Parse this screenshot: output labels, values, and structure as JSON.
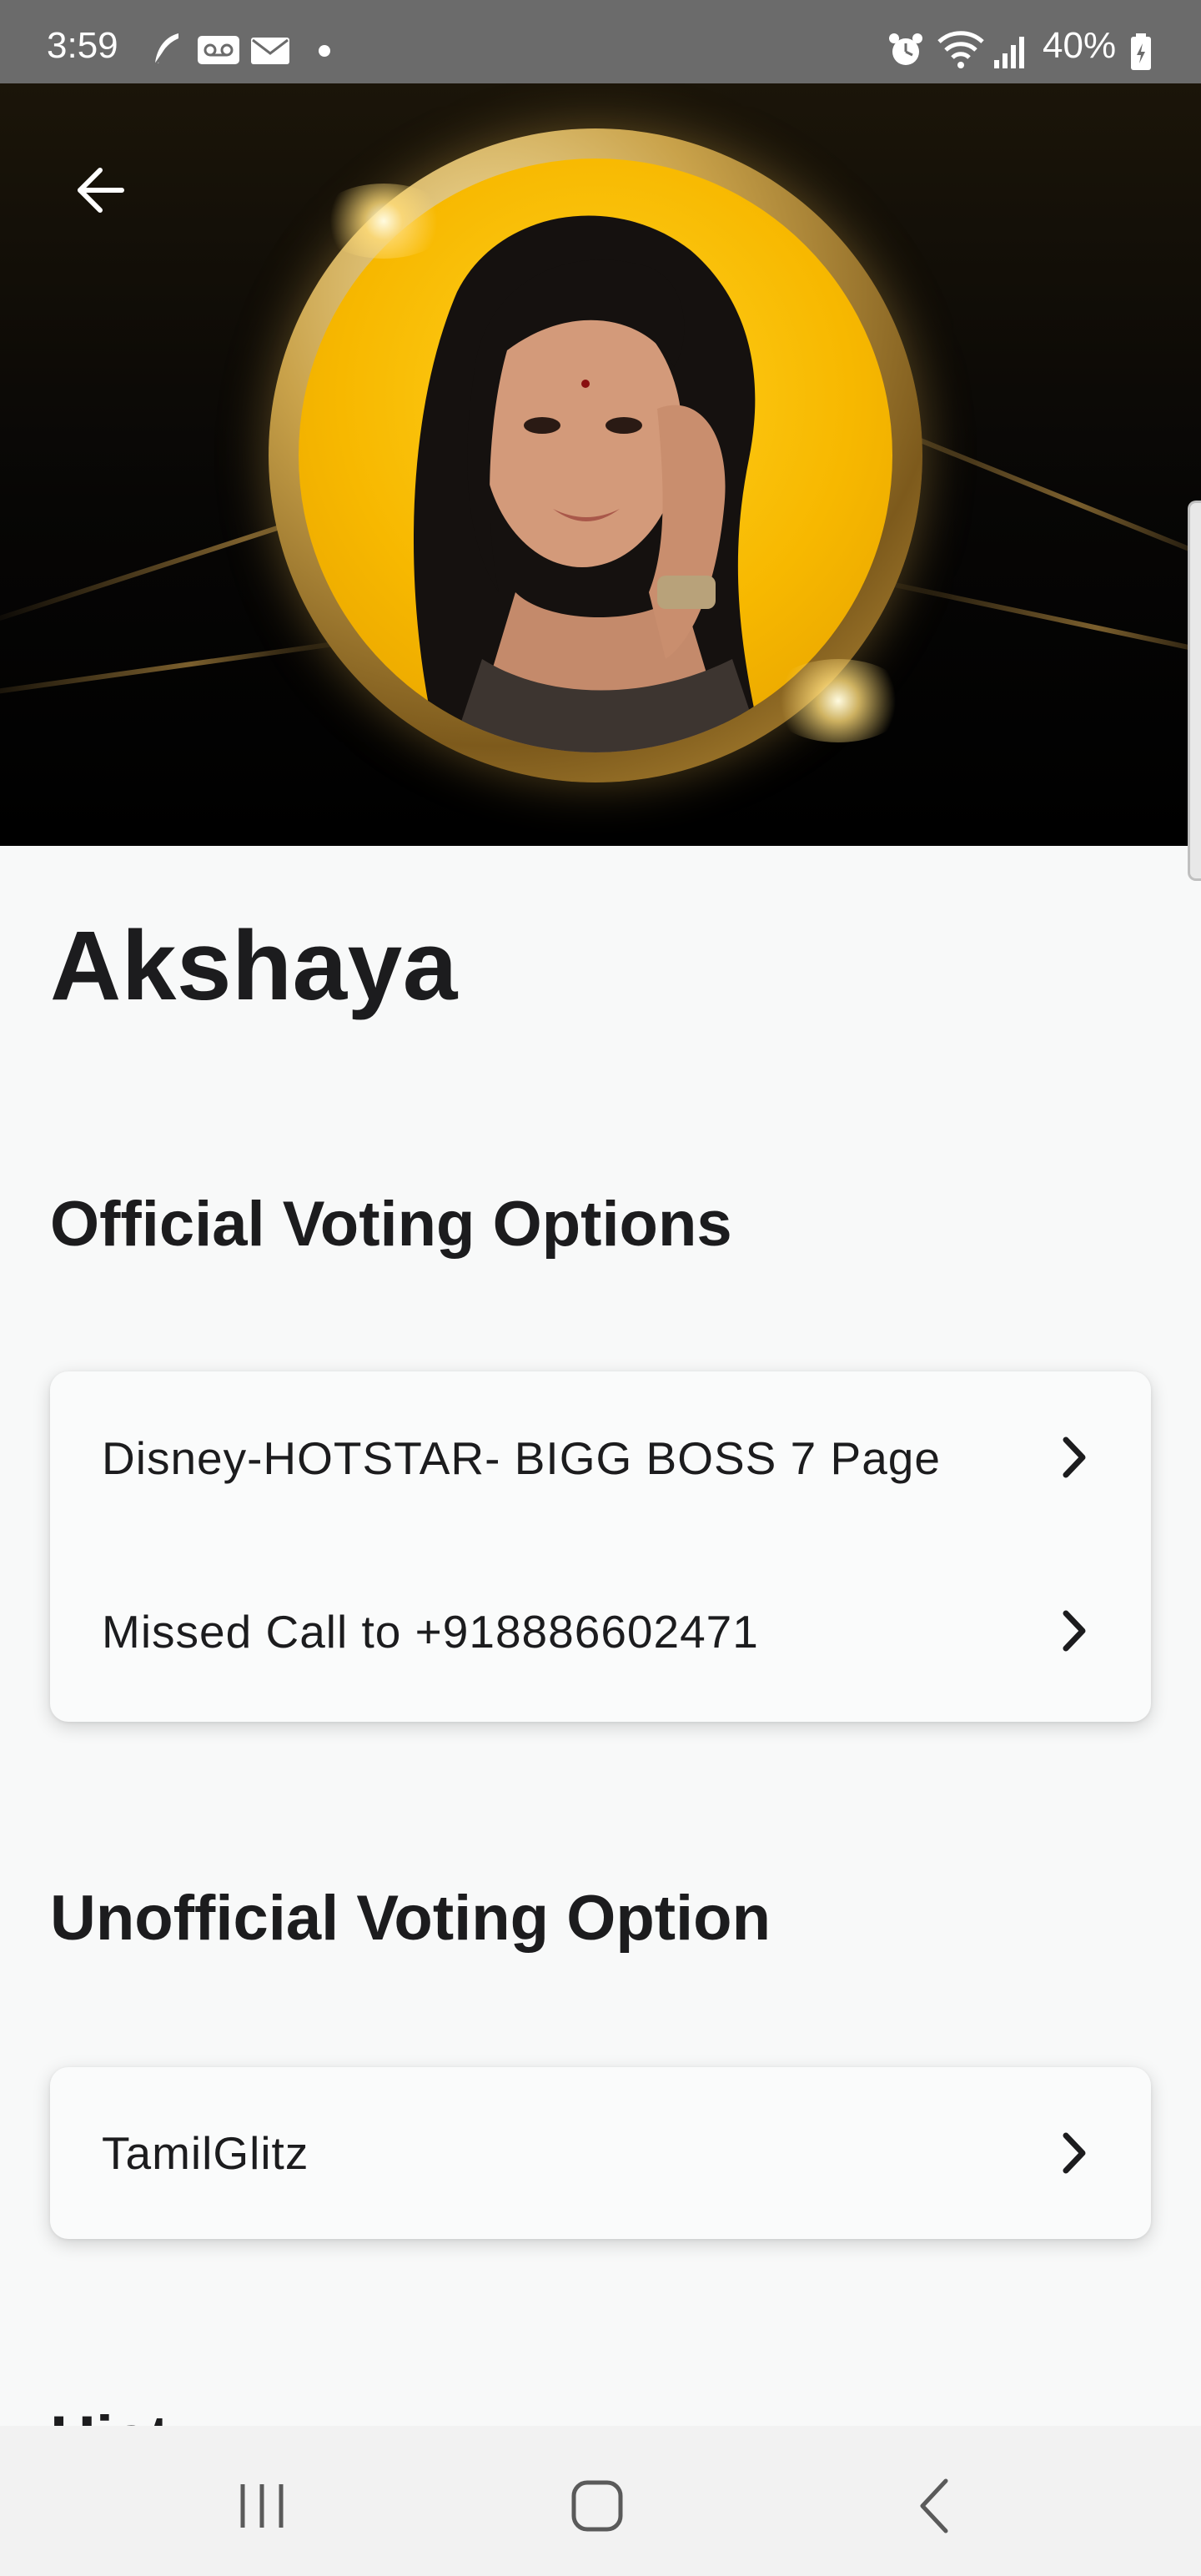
{
  "status_bar": {
    "time": "3:59",
    "battery": "40%",
    "icons": [
      "feather-icon",
      "voicemail-icon",
      "mail-icon",
      "notification-dot-icon",
      "alarm-icon",
      "wifi-icon",
      "signal-icon",
      "battery-icon"
    ]
  },
  "hero": {
    "back_icon": "arrow-left-icon"
  },
  "contestant": {
    "name": "Akshaya"
  },
  "official": {
    "heading": "Official Voting Options",
    "items": [
      {
        "label": "Disney-HOTSTAR- BIGG BOSS 7 Page",
        "icon": "chevron-right-icon"
      },
      {
        "label": "Missed Call to +918886602471",
        "icon": "chevron-right-icon"
      }
    ]
  },
  "unofficial": {
    "heading": "Unofficial Voting Option",
    "items": [
      {
        "label": "TamilGlitz",
        "icon": "chevron-right-icon"
      }
    ]
  },
  "next_section": {
    "heading_partial": "Hist"
  },
  "nav_bar": {
    "buttons": [
      "recent-apps-icon",
      "home-icon",
      "back-icon"
    ]
  },
  "colors": {
    "accent_gold": "#f7b800",
    "background": "#f8f9f9",
    "text": "#1c1c1e"
  }
}
